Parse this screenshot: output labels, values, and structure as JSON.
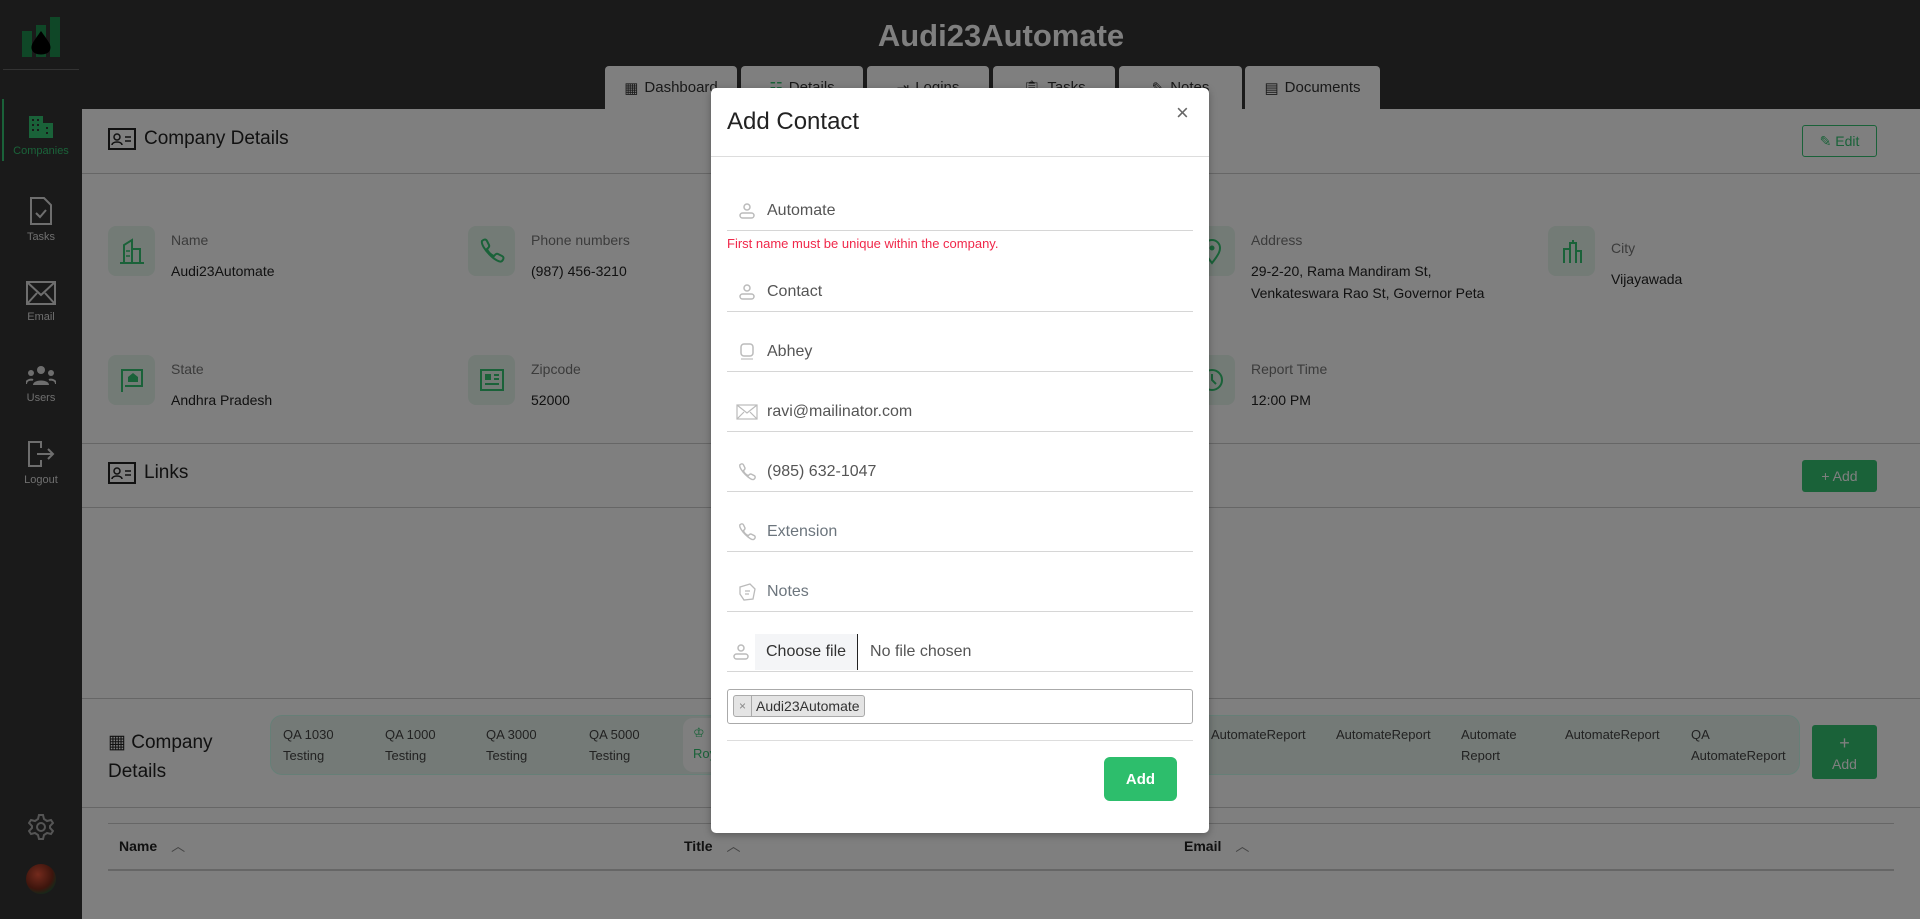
{
  "app": {
    "title": "Audi23Automate"
  },
  "colors": {
    "accent": "#34c472",
    "modal_button": "#2dbe6c",
    "error": "#f0284a",
    "sidebar": "#1b1b1b"
  },
  "sidebar": {
    "items": [
      {
        "label": "Companies",
        "icon": "building-icon",
        "active": true
      },
      {
        "label": "Tasks",
        "icon": "task-file-icon"
      },
      {
        "label": "Email",
        "icon": "envelope-icon"
      },
      {
        "label": "Users",
        "icon": "users-icon"
      },
      {
        "label": "Logout",
        "icon": "logout-icon"
      }
    ],
    "settings_icon": "gear-icon",
    "avatar": "user-avatar"
  },
  "tabs": [
    {
      "label": "Dashboard",
      "icon": "grid-icon"
    },
    {
      "label": "Details",
      "icon": "list-icon"
    },
    {
      "label": "Logins",
      "icon": "login-icon"
    },
    {
      "label": "Tasks",
      "icon": "clipboard-icon"
    },
    {
      "label": "Notes",
      "icon": "notes-icon"
    },
    {
      "label": "Documents",
      "icon": "document-icon"
    }
  ],
  "company_details": {
    "title": "Company Details",
    "edit_label": "Edit",
    "fields": [
      {
        "label": "Name",
        "value": "Audi23Automate"
      },
      {
        "label": "Phone numbers",
        "value": "(987) 456-3210"
      },
      {
        "label": "Address",
        "value": "29-2-20, Rama Mandiram St, Venkateswara Rao St, Governor Peta"
      },
      {
        "label": "City",
        "value": "Vijayawada"
      },
      {
        "label": "State",
        "value": "Andhra Pradesh"
      },
      {
        "label": "Zipcode",
        "value": "52000"
      },
      {
        "label": "Report Time",
        "value": "12:00 PM"
      }
    ]
  },
  "links": {
    "title": "Links",
    "add_label": "+ Add"
  },
  "contacts_section": {
    "title_line1": "Company",
    "title_line2": "Details",
    "add_plus": "+",
    "add_label": "Add",
    "companies": [
      {
        "l1": "QA 1030",
        "l2": "Testing"
      },
      {
        "l1": "QA 1000",
        "l2": "Testing"
      },
      {
        "l1": "QA 3000",
        "l2": "Testing"
      },
      {
        "l1": "QA 5000",
        "l2": "Testing"
      },
      {
        "l1": "",
        "l2": "Roy",
        "selected": true
      },
      {
        "l1": "AutomateReport",
        "l2": ""
      },
      {
        "l1": "AutomateReport",
        "l2": ""
      },
      {
        "l1": "Automate",
        "l2": "Report"
      },
      {
        "l1": "AutomateReport",
        "l2": ""
      },
      {
        "l1": "QA",
        "l2": "AutomateReport"
      }
    ],
    "table_headers": [
      "Name",
      "Title",
      "Email"
    ]
  },
  "modal": {
    "title": "Add Contact",
    "close": "×",
    "first_name": "Automate",
    "first_name_error": "First name must be unique within the company.",
    "last_name": "Contact",
    "title_field": "Abhey",
    "email": "ravi@mailinator.com",
    "phone": "(985) 632-1047",
    "extension_placeholder": "Extension",
    "notes_placeholder": "Notes",
    "file_button": "Choose file",
    "file_status": "No file chosen",
    "company_tag_remove": "×",
    "company_tag": "Audi23Automate",
    "submit": "Add"
  }
}
